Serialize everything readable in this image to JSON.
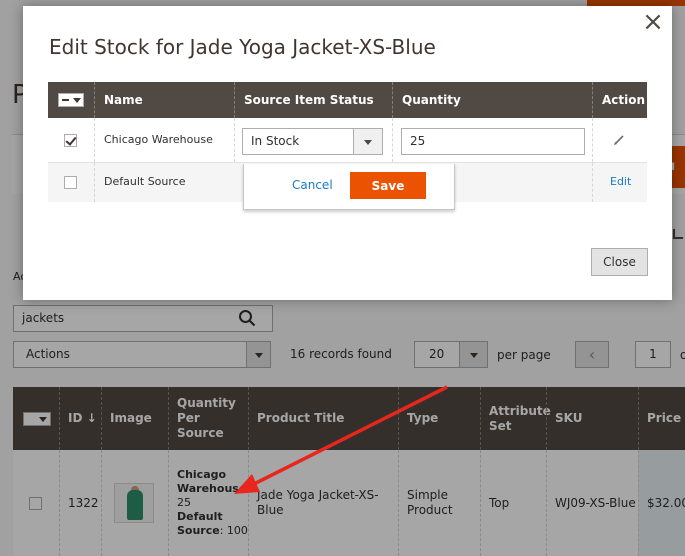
{
  "modal": {
    "title": "Edit Stock for Jade Yoga Jacket-XS-Blue",
    "close_label": "Close",
    "columns": [
      "Name",
      "Source Item Status",
      "Quantity",
      "Action"
    ],
    "rows": [
      {
        "name": "Chicago Warehouse",
        "status": "In Stock",
        "quantity": "25",
        "checked": true
      },
      {
        "name": "Default Source",
        "action_label": "Edit",
        "checked": false
      }
    ],
    "inline_cancel": "Cancel",
    "inline_save": "Save"
  },
  "background": {
    "page_letter": "P",
    "orange_button_fragment": "u",
    "ac_fragment": "Ac",
    "search_value": "jackets",
    "actions_label": "Actions",
    "records_found": "16 records found",
    "per_page_value": "20",
    "per_page_label": "per page",
    "prev_arrow": "‹",
    "current_page": "1",
    "of_fragment": "o",
    "table": {
      "headers": [
        "ID",
        "Image",
        "Quantity Per Source",
        "Product Title",
        "Type",
        "Attribute Set",
        "SKU",
        "Price"
      ],
      "id_sort_arrow": "↓",
      "row": {
        "id": "1322",
        "qps_label1": "Chicago",
        "qps_label2": "Warehouse",
        "qps_value1": ": 25",
        "qps_label3": "Default",
        "qps_label4": "Source",
        "qps_value2": ": 100",
        "product_title": "Jade Yoga Jacket-XS-Blue",
        "type": "Simple Product",
        "attribute_set": "Top",
        "sku": "WJ09-XS-Blue",
        "price": "$32.00"
      }
    }
  },
  "colors": {
    "accent": "#eb5202",
    "header_dark": "#514943",
    "link": "#1979c3",
    "annotation_arrow": "#e8261d"
  }
}
